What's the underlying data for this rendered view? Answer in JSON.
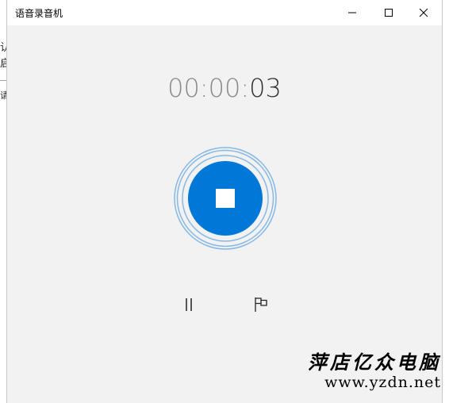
{
  "background_window": {
    "fragments": [
      "认",
      "启",
      "请"
    ]
  },
  "window": {
    "title": "语音录音机",
    "controls": {
      "minimize": "minimize-icon",
      "maximize": "maximize-icon",
      "close": "close-icon"
    }
  },
  "recorder": {
    "timer_dim": "00:00:",
    "timer_bright": "03",
    "stop_icon": "stop-icon",
    "pause_icon": "pause-icon",
    "marker_icon": "flag-icon"
  },
  "colors": {
    "accent": "#0078d7",
    "ring": "#86b8e6",
    "app_bg": "#f2f2f2"
  },
  "watermark": {
    "chinese": "萍店亿众电脑",
    "url": "www.yzdn.net"
  }
}
